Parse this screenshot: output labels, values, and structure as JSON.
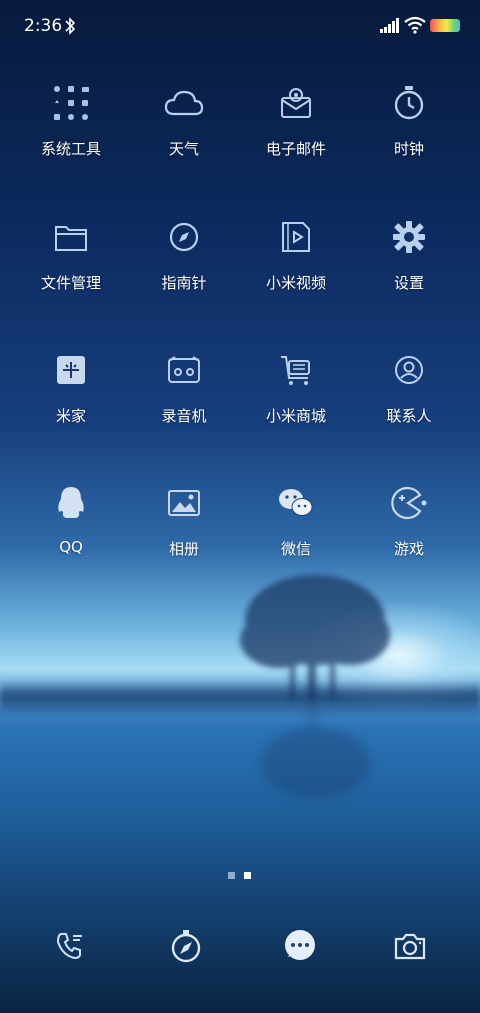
{
  "status_bar": {
    "time": "2:36",
    "icons": [
      "bluetooth-icon",
      "signal-icon",
      "wifi-icon",
      "battery-icon"
    ]
  },
  "apps": [
    {
      "label": "系统工具",
      "icon": "folder-grid-icon"
    },
    {
      "label": "天气",
      "icon": "cloud-icon"
    },
    {
      "label": "电子邮件",
      "icon": "mail-icon"
    },
    {
      "label": "时钟",
      "icon": "stopwatch-icon"
    },
    {
      "label": "文件管理",
      "icon": "folder-icon"
    },
    {
      "label": "指南针",
      "icon": "compass-icon"
    },
    {
      "label": "小米视频",
      "icon": "video-icon"
    },
    {
      "label": "设置",
      "icon": "gear-icon"
    },
    {
      "label": "米家",
      "icon": "mijia-icon"
    },
    {
      "label": "录音机",
      "icon": "recorder-icon"
    },
    {
      "label": "小米商城",
      "icon": "cart-icon"
    },
    {
      "label": "联系人",
      "icon": "contact-icon"
    },
    {
      "label": "QQ",
      "icon": "qq-penguin-icon"
    },
    {
      "label": "相册",
      "icon": "gallery-icon"
    },
    {
      "label": "微信",
      "icon": "wechat-icon"
    },
    {
      "label": "游戏",
      "icon": "game-icon"
    }
  ],
  "pager": {
    "pages": 2,
    "current": 2
  },
  "dock": [
    {
      "icon": "phone-icon"
    },
    {
      "icon": "browser-compass-icon"
    },
    {
      "icon": "messages-icon"
    },
    {
      "icon": "camera-icon"
    }
  ]
}
